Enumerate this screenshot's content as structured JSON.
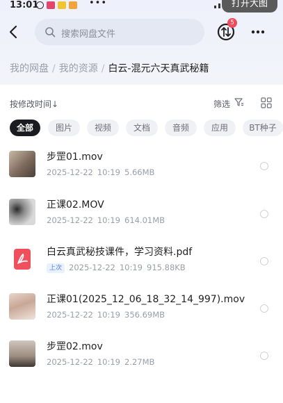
{
  "status_bar": {
    "time": "13:01",
    "dots": "•••"
  },
  "open_big_button": "打开大图",
  "search": {
    "placeholder": "搜索网盘文件"
  },
  "transfer_badge": "5",
  "breadcrumb": {
    "items": [
      "我的网盘",
      "我的资源"
    ],
    "separator": "/",
    "current": "白云-混元六天真武秘籍"
  },
  "toolbar": {
    "sort_label": "按修改时间↓",
    "filter_label": "筛选"
  },
  "filters": [
    "全部",
    "图片",
    "视频",
    "文档",
    "音频",
    "应用",
    "BT种子"
  ],
  "files": [
    {
      "name": "步罡01.mov",
      "date": "2025-12-22",
      "time": "10:19",
      "size": "5.66MB",
      "type": "video"
    },
    {
      "name": "正课02.MOV",
      "date": "2025-12-22",
      "time": "10:19",
      "size": "614.01MB",
      "type": "video"
    },
    {
      "name": "白云真武秘技课件，学习资料.pdf",
      "tag": "上次",
      "date": "2025-12-22",
      "time": "10:19",
      "size": "915.88KB",
      "type": "pdf"
    },
    {
      "name": "正课01(2025_12_06_18_32_14_997).mov",
      "date": "2025-12-22",
      "time": "10:19",
      "size": "356.69MB",
      "type": "video"
    },
    {
      "name": "步罡02.mov",
      "date": "2025-12-22",
      "time": "10:19",
      "size": "2.27MB",
      "type": "video"
    }
  ],
  "colors": {
    "active_chip": "#1b1c21",
    "badge": "#f24a5d",
    "pdf_icon": "#f0505e"
  }
}
